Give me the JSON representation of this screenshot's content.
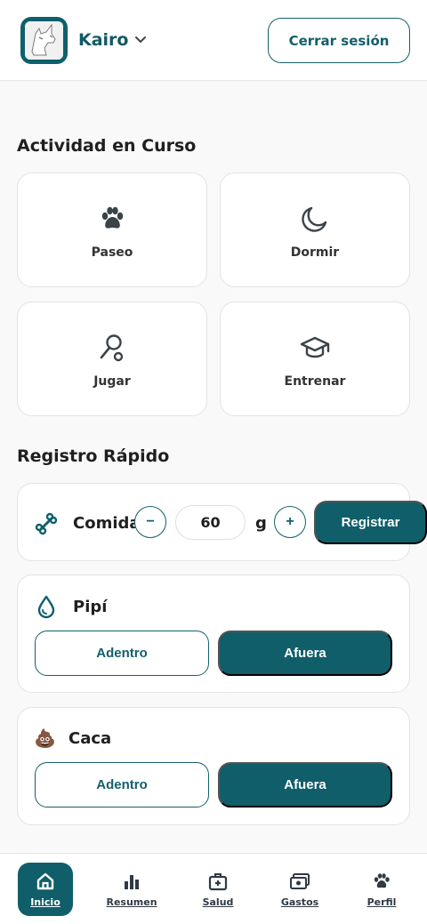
{
  "header": {
    "pet_name": "Kairo",
    "logout_label": "Cerrar sesión"
  },
  "activity": {
    "title": "Actividad en Curso",
    "items": [
      {
        "label": "Paseo",
        "icon": "paw-icon"
      },
      {
        "label": "Dormir",
        "icon": "moon-icon"
      },
      {
        "label": "Jugar",
        "icon": "toy-icon"
      },
      {
        "label": "Entrenar",
        "icon": "graduation-cap-icon"
      }
    ]
  },
  "quick_log": {
    "title": "Registro Rápido",
    "food": {
      "label": "Comida",
      "quantity": "60",
      "unit": "g",
      "minus": "−",
      "plus": "+",
      "submit_label": "Registrar"
    },
    "pee": {
      "label": "Pipí",
      "inside_label": "Adentro",
      "outside_label": "Afuera"
    },
    "poop": {
      "label": "Caca",
      "emoji": "💩",
      "inside_label": "Adentro",
      "outside_label": "Afuera"
    }
  },
  "nav": {
    "items": [
      {
        "label": "Inicio",
        "icon": "home-icon",
        "active": true
      },
      {
        "label": "Resumen",
        "icon": "bar-chart-icon"
      },
      {
        "label": "Salud",
        "icon": "medical-kit-icon"
      },
      {
        "label": "Gastos",
        "icon": "money-icon"
      },
      {
        "label": "Perfil",
        "icon": "paw-icon"
      }
    ]
  },
  "colors": {
    "primary": "#105e6a",
    "text": "#1f1f1f",
    "background": "#f9f9f9"
  }
}
